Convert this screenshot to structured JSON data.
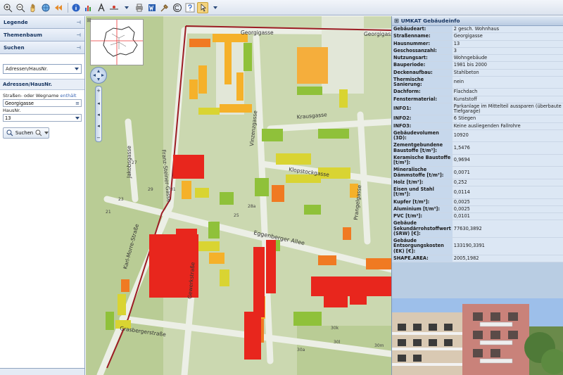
{
  "sidebar": {
    "legend_label": "Legende",
    "tree_label": "Themenbaum",
    "search_label": "Suchen",
    "search_type": "Adressen/HausNr.",
    "section_label": "Adressen/HausNr.",
    "street_label": "Straßen- oder Wegname",
    "street_link": "enthält",
    "street_value": "Georgigasse",
    "house_label": "HausNr.",
    "house_value": "13",
    "search_button": "Suchen"
  },
  "map": {
    "streets": [
      "Georgigasse",
      "Georgigasse",
      "Krausgasse",
      "Vinzenzgasse",
      "Klopstockgasse",
      "Prangelgasse",
      "Franz-Steiner-Gasse",
      "Jakobsgasse",
      "Karl-Morre-Straße",
      "Eggenberger Allee",
      "Gewerkstraße",
      "Grasbergerstraße"
    ],
    "house_numbers": [
      "27",
      "21",
      "23",
      "29",
      "31",
      "28a",
      "25",
      "30k",
      "30l",
      "30m",
      "30a"
    ]
  },
  "info": {
    "title": "UMKAT Gebäudeinfo",
    "rows": [
      {
        "k": "Gebäudeart:",
        "v": "2 gesch. Wohnhaus"
      },
      {
        "k": "Straßenname:",
        "v": "Georgigasse"
      },
      {
        "k": "Hausnummer:",
        "v": "13"
      },
      {
        "k": "Geschossanzahl:",
        "v": "3"
      },
      {
        "k": "Nutzungsart:",
        "v": "Wohngebäude"
      },
      {
        "k": "Bauperiode:",
        "v": "1981 bis 2000"
      },
      {
        "k": "Deckenaufbau:",
        "v": "Stahlbeton"
      },
      {
        "k": "Thermische Sanierung:",
        "v": "nein"
      },
      {
        "k": "Dachform:",
        "v": "Flachdach"
      },
      {
        "k": "Fenstermaterial:",
        "v": "Kunststoff"
      },
      {
        "k": "INFO1:",
        "v": "Parkanlage im Mittelteil aussparen (überbaute Tiefgarage)"
      },
      {
        "k": "INFO2:",
        "v": "6 Stiegen"
      },
      {
        "k": "INFO3:",
        "v": "Keine ausliegenden Fallrohre"
      },
      {
        "k": "Gebäudevolumen (3D):",
        "v": "10920"
      },
      {
        "k": "Zementgebundene Baustoffe [t/m³]:",
        "v": "1,5476"
      },
      {
        "k": "Keramische Baustoffe [t/m³]:",
        "v": "0,9694"
      },
      {
        "k": "Mineralische Dämmstoffe [t/m³]:",
        "v": "0,0071"
      },
      {
        "k": "Holz [t/m³]:",
        "v": "0,252"
      },
      {
        "k": "Eisen und Stahl [t/m³]:",
        "v": "0,0114"
      },
      {
        "k": "Kupfer [t/m³]:",
        "v": "0,0025"
      },
      {
        "k": "Aluminium [t/m³]:",
        "v": "0,0025"
      },
      {
        "k": "PVC [t/m³]:",
        "v": "0,0101"
      },
      {
        "k": "Gebäude Sekundärrohstoffwert (SRW) [€]:",
        "v": "77630,3892"
      },
      {
        "k": "Gebäude Entsorgungskosten (EK) [€]:",
        "v": "133190,3391"
      },
      {
        "k": "SHAPE.AREA:",
        "v": "2005,1982"
      }
    ]
  },
  "colors": {
    "critical": "#e8261d",
    "high": "#f07a22",
    "medium": "#f5b12a",
    "low": "#c6d631",
    "good": "#7bbf3a",
    "panel": "#b9cde3"
  },
  "toolbar_icons": [
    "zoom-in-icon",
    "zoom-out-icon",
    "pan-icon",
    "full-extent-icon",
    "previous-view-icon",
    "info-icon",
    "chart-icon",
    "text-icon",
    "measure-icon",
    "print-icon",
    "word-export-icon",
    "tools-icon",
    "copyright-icon",
    "help-icon",
    "pointer-icon"
  ]
}
